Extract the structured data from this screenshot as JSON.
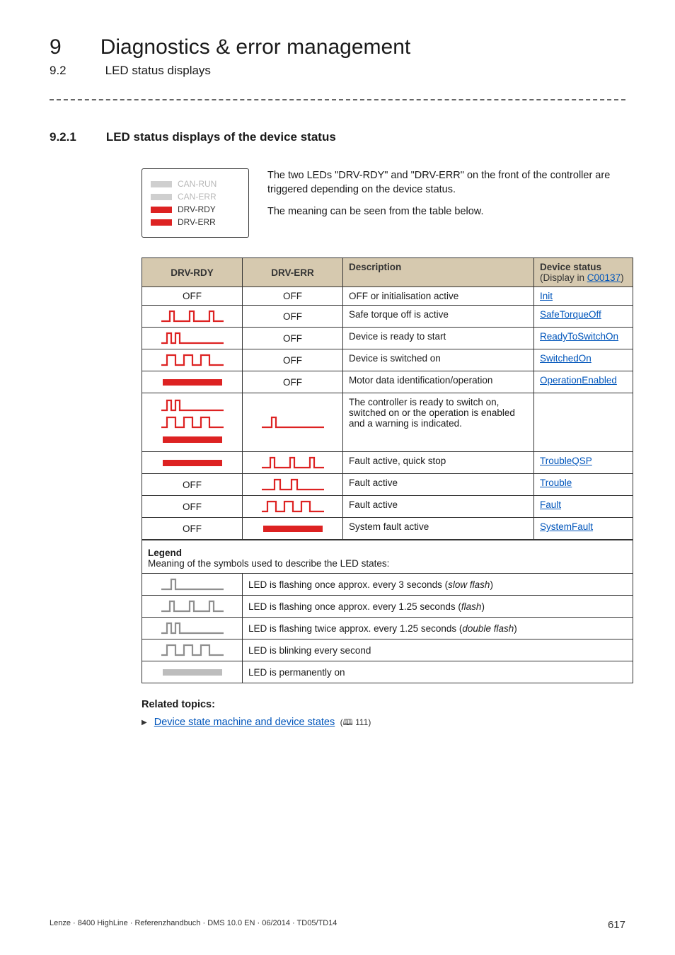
{
  "chapter": {
    "num": "9",
    "title": "Diagnostics & error management"
  },
  "subsection": {
    "num": "9.2",
    "title": "LED status displays"
  },
  "section": {
    "num": "9.2.1",
    "title": "LED status displays of the device status"
  },
  "panel": {
    "items": [
      {
        "label": "CAN-RUN",
        "enabled": false,
        "color": "grey"
      },
      {
        "label": "CAN-ERR",
        "enabled": false,
        "color": "grey"
      },
      {
        "label": "DRV-RDY",
        "enabled": true,
        "color": "red"
      },
      {
        "label": "DRV-ERR",
        "enabled": true,
        "color": "red"
      }
    ]
  },
  "intro": {
    "p1": "The two LEDs \"DRV-RDY\" and \"DRV-ERR\" on the front of the controller are triggered depending on the device status.",
    "p2": "The meaning can be seen from the table below."
  },
  "table": {
    "headers": {
      "c1": "DRV-RDY",
      "c2": "DRV-ERR",
      "c3": "Description",
      "c4a": "Device status",
      "c4b_pre": "(Display in ",
      "c4b_link": "C00137",
      "c4b_post": ")"
    },
    "rows": [
      {
        "rdy": "OFF_TEXT",
        "err": "OFF_TEXT",
        "desc": "OFF or initialisation active",
        "status": "Init"
      },
      {
        "rdy": "FLASH_RED",
        "err": "OFF_TEXT",
        "desc": "Safe torque off is active",
        "status": "SafeTorqueOff"
      },
      {
        "rdy": "DBLFLASH_RED",
        "err": "OFF_TEXT",
        "desc": "Device is ready to start",
        "status": "ReadyToSwitchOn"
      },
      {
        "rdy": "BLINK_RED",
        "err": "OFF_TEXT",
        "desc": "Device is switched on",
        "status": "SwitchedOn"
      },
      {
        "rdy": "ON_RED",
        "err": "OFF_TEXT",
        "desc": "Motor data identification/operation",
        "status": "OperationEnabled"
      },
      {
        "rdy": "TRIPLE",
        "err": "SLOW_RED",
        "desc": "The controller is ready to switch on, switched on or the operation is enabled and a warning is indicated.",
        "status": ""
      },
      {
        "rdy": "ON_RED",
        "err": "FLASH_RED",
        "desc": "Fault active, quick stop",
        "status": "TroubleQSP"
      },
      {
        "rdy": "OFF_TEXT",
        "err": "DBLFLASH_RED_ALT",
        "desc": "Fault active",
        "status": "Trouble"
      },
      {
        "rdy": "OFF_TEXT",
        "err": "BLINK_RED",
        "desc": "Fault active",
        "status": "Fault"
      },
      {
        "rdy": "OFF_TEXT",
        "err": "ON_RED",
        "desc": "System fault active",
        "status": "SystemFault"
      }
    ]
  },
  "legend": {
    "title": "Legend",
    "subtitle": "Meaning of the symbols used to describe the LED states:",
    "rows": [
      {
        "icon": "SLOW_GREY",
        "text_pre": "LED is flashing once approx. every 3 seconds (",
        "text_it": "slow flash",
        "text_post": ")"
      },
      {
        "icon": "FLASH_GREY",
        "text_pre": "LED is flashing once approx. every 1.25 seconds (",
        "text_it": "flash",
        "text_post": ")"
      },
      {
        "icon": "DBLFLASH_GREY",
        "text_pre": "LED is flashing twice approx. every 1.25 seconds (",
        "text_it": "double flash",
        "text_post": ")"
      },
      {
        "icon": "BLINK_GREY",
        "text_pre": "LED is blinking every second",
        "text_it": "",
        "text_post": ""
      },
      {
        "icon": "ON_GREY",
        "text_pre": "LED is permanently on",
        "text_it": "",
        "text_post": ""
      }
    ]
  },
  "related": {
    "title": "Related topics:",
    "item_text": "Device state machine and device states",
    "page_ref": "111"
  },
  "footer": {
    "left": "Lenze · 8400 HighLine · Referenzhandbuch · DMS 10.0 EN · 06/2014 · TD05/TD14",
    "right": "617"
  },
  "labels": {
    "off": "OFF"
  },
  "colors": {
    "red": "#d22",
    "grey": "#bdbdbd",
    "grey_dark": "#8f8f8f"
  }
}
